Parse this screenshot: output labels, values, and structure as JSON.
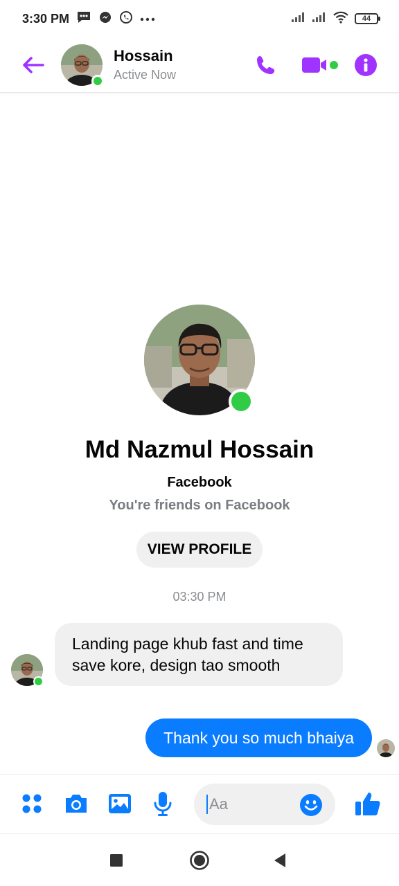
{
  "status_bar": {
    "time": "3:30 PM",
    "battery": "44"
  },
  "header": {
    "name": "Hossain",
    "status": "Active Now"
  },
  "profile": {
    "full_name": "Md Nazmul Hossain",
    "platform": "Facebook",
    "relation": "You're friends on Facebook",
    "view_profile_label": "VIEW PROFILE"
  },
  "conversation": {
    "timestamp": "03:30 PM",
    "messages": [
      {
        "direction": "incoming",
        "text": "Landing page khub fast and time save kore, design tao smooth"
      },
      {
        "direction": "outgoing",
        "text": "Thank you so much bhaiya"
      }
    ]
  },
  "composer": {
    "placeholder": "Aa"
  },
  "colors": {
    "messenger_purple": "#a033ff",
    "messenger_blue": "#0a7cff",
    "online_green": "#31cc46",
    "bubble_gray": "#f0f0f0"
  },
  "icons": {
    "header": [
      "back-arrow-icon",
      "phone-icon",
      "video-camera-icon",
      "info-icon"
    ],
    "composer": [
      "apps-icon",
      "camera-icon",
      "gallery-icon",
      "microphone-icon",
      "emoji-icon",
      "thumbs-up-icon"
    ],
    "navigation": [
      "recents-square-icon",
      "home-circle-icon",
      "back-triangle-icon"
    ]
  }
}
